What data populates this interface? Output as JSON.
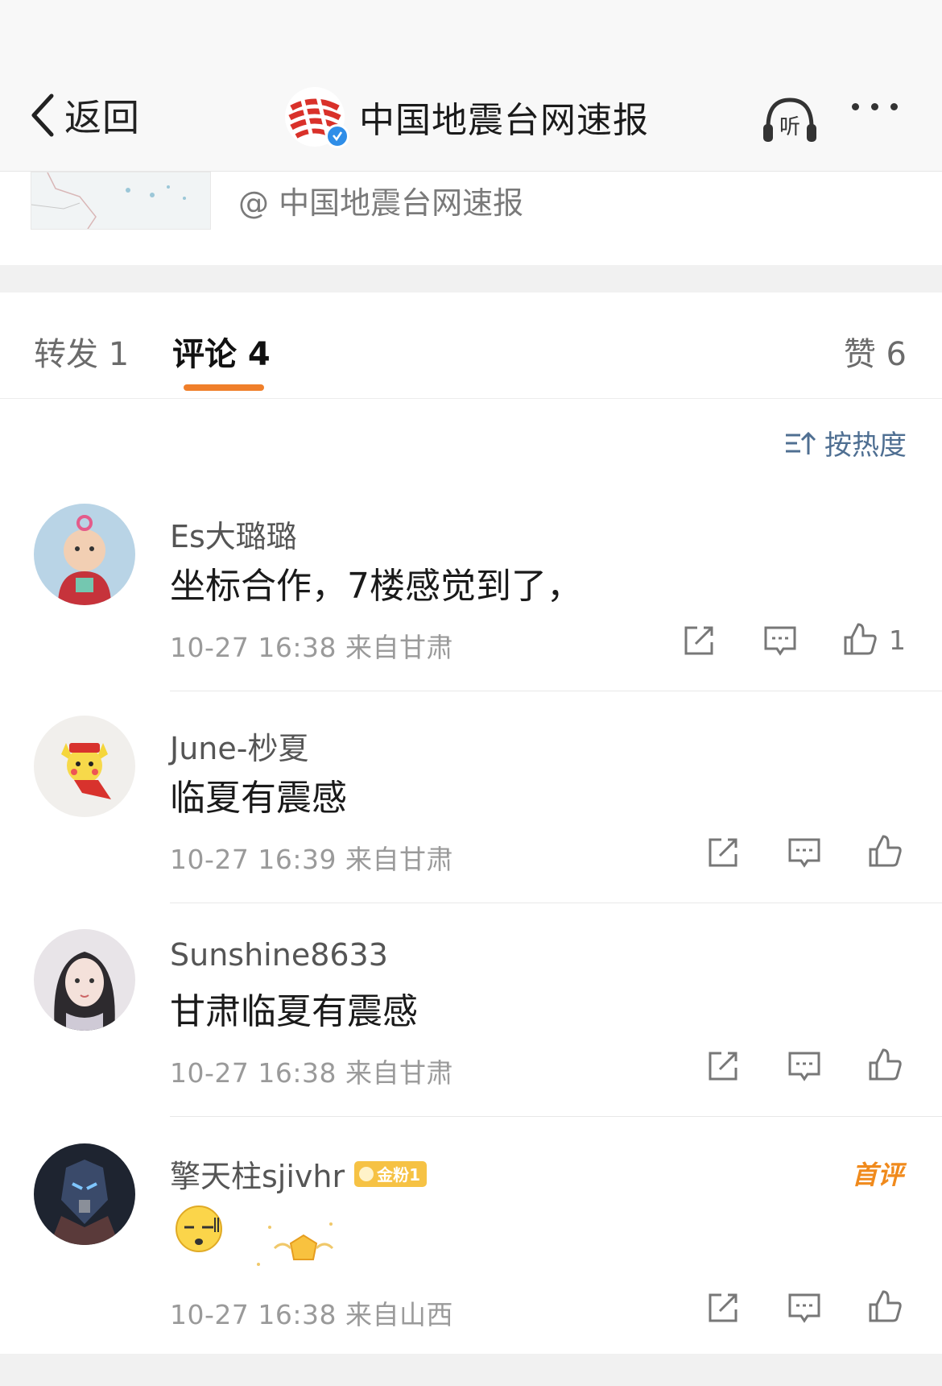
{
  "header": {
    "back_label": "返回",
    "title": "中国地震台网速报",
    "listen_label": "听"
  },
  "post": {
    "repost_author": "@ 中国地震台网速报"
  },
  "tabs": [
    {
      "label": "转发 1"
    },
    {
      "label": "评论 4",
      "active": true
    },
    {
      "label": "赞 6"
    }
  ],
  "sort_label": "按热度",
  "accent_color": "#f07f2a",
  "comments": [
    {
      "name": "Es大璐璐",
      "text": "坐标合作，7楼感觉到了，",
      "meta": "10-27 16:38  来自甘肃",
      "likes": "1"
    },
    {
      "name": "June-杪夏",
      "text": "临夏有震感",
      "meta": "10-27 16:39  来自甘肃",
      "likes": ""
    },
    {
      "name": "Sunshine8633",
      "text": "甘肃临夏有震感",
      "meta": "10-27 16:38  来自甘肃",
      "likes": ""
    },
    {
      "name": "擎天柱sjivhr",
      "badge": "金粉1",
      "tag": "首评",
      "text": "",
      "meta": "10-27 16:38  来自山西",
      "likes": ""
    }
  ]
}
